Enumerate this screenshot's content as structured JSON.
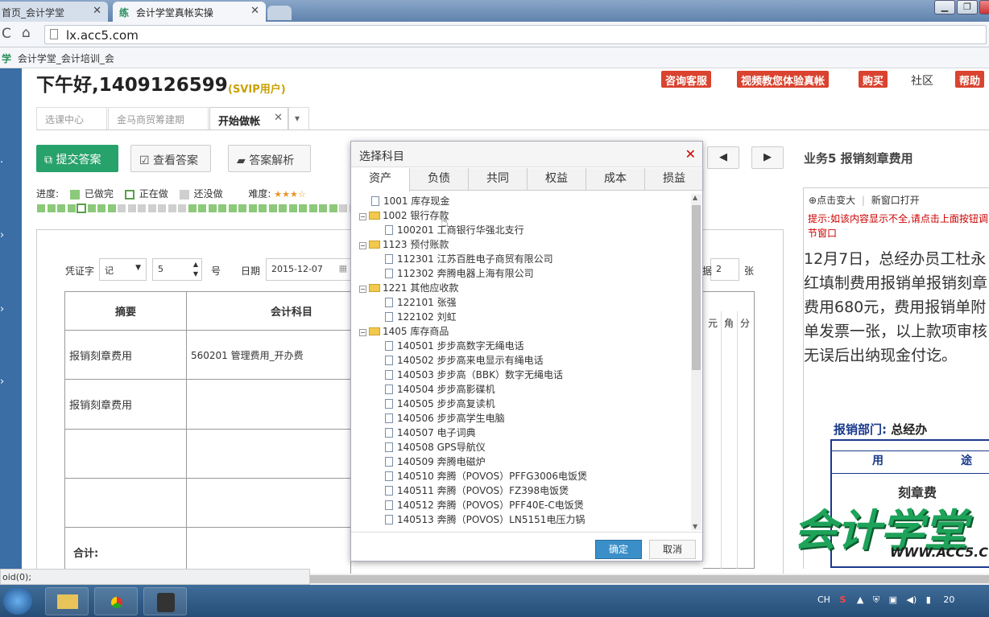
{
  "browser": {
    "tabs": [
      {
        "label": "首页_会计学堂"
      },
      {
        "label": "会计学堂真帐实操",
        "favicon": "练"
      }
    ],
    "url": "lx.acc5.com",
    "bookmark": "会计学堂_会计培训_会",
    "bookmark_icon": "学"
  },
  "header": {
    "greeting": "下午好,1409126599",
    "user_level": "(SVIP用户)",
    "buttons": [
      "咨询客服",
      "视频教您体验真帐",
      "购买",
      "帮助"
    ],
    "community": "社区"
  },
  "page_tabs": [
    "选课中心",
    "金马商贸筹建期",
    "开始做帐"
  ],
  "toolbar": {
    "submit": "提交答案",
    "view": "查看答案",
    "analysis": "答案解析"
  },
  "progress": {
    "label": "进度:",
    "done": "已做完",
    "doing": "正在做",
    "todo": "还没做",
    "difficulty": "难度:",
    "colors": {
      "done": "#8cc97a",
      "doing": "#ffffff",
      "todo": "#cfcfcf"
    }
  },
  "voucher": {
    "word_label": "凭证字",
    "word_value": "记",
    "number_value": "5",
    "number_unit": "号",
    "date_label": "日期",
    "date_value": "2015-12-07",
    "attach_value": "2",
    "attach_unit": "张",
    "col_summary": "摘要",
    "col_account": "会计科目",
    "money_cols": [
      "元",
      "角",
      "分"
    ],
    "rows": [
      {
        "summary": "报销刻章费用",
        "account": "560201 管理费用_开办费"
      },
      {
        "summary": "报销刻章费用",
        "account": ""
      }
    ],
    "total_label": "合计:"
  },
  "right_panel": {
    "title": "业务5 报销刻章费用",
    "tool_zoom": "点击变大",
    "tool_newwin": "新窗口打开",
    "hint": "提示:如该内容显示不全,请点击上面按钮调节窗口",
    "description": "12月7日，总经办员工杜永红填制费用报销单报销刻章费用680元，费用报销单附单发票一张，以上款项审核无误后出纳现金付讫。",
    "reimb_dept_label": "报销部门:",
    "reimb_dept_value": "总经办",
    "reimb_col1": "用",
    "reimb_col2": "途",
    "reimb_item": "刻章费",
    "watermark": "会计学堂",
    "watermark_url": "WWW.ACC5.C"
  },
  "dialog": {
    "title": "选择科目",
    "tabs": [
      "资产",
      "负债",
      "共同",
      "权益",
      "成本",
      "损益"
    ],
    "active_tab": "资产",
    "tree": [
      {
        "text": "1001 库存现金",
        "level": 0,
        "kind": "leaf"
      },
      {
        "text": "1002 银行存款",
        "level": 0,
        "kind": "folder"
      },
      {
        "text": "100201 工商银行华强北支行",
        "level": 1,
        "kind": "leaf"
      },
      {
        "text": "1123 预付账款",
        "level": 0,
        "kind": "folder"
      },
      {
        "text": "112301 江苏百胜电子商贸有限公司",
        "level": 1,
        "kind": "leaf"
      },
      {
        "text": "112302 奔腾电器上海有限公司",
        "level": 1,
        "kind": "leaf"
      },
      {
        "text": "1221 其他应收款",
        "level": 0,
        "kind": "folder"
      },
      {
        "text": "122101 张强",
        "level": 1,
        "kind": "leaf"
      },
      {
        "text": "122102 刘虹",
        "level": 1,
        "kind": "leaf"
      },
      {
        "text": "1405 库存商品",
        "level": 0,
        "kind": "folder"
      },
      {
        "text": "140501 步步高数字无绳电话",
        "level": 1,
        "kind": "leaf"
      },
      {
        "text": "140502 步步高来电显示有绳电话",
        "level": 1,
        "kind": "leaf"
      },
      {
        "text": "140503 步步高（BBK）数字无绳电话",
        "level": 1,
        "kind": "leaf"
      },
      {
        "text": "140504 步步高影碟机",
        "level": 1,
        "kind": "leaf"
      },
      {
        "text": "140505 步步高复读机",
        "level": 1,
        "kind": "leaf"
      },
      {
        "text": "140506 步步高学生电脑",
        "level": 1,
        "kind": "leaf"
      },
      {
        "text": "140507 电子词典",
        "level": 1,
        "kind": "leaf"
      },
      {
        "text": "140508 GPS导航仪",
        "level": 1,
        "kind": "leaf"
      },
      {
        "text": "140509 奔腾电磁炉",
        "level": 1,
        "kind": "leaf"
      },
      {
        "text": "140510 奔腾（POVOS）PFFG3006电饭煲",
        "level": 1,
        "kind": "leaf"
      },
      {
        "text": "140511 奔腾（POVOS）FZ398电饭煲",
        "level": 1,
        "kind": "leaf"
      },
      {
        "text": "140512 奔腾（POVOS）PFF40E-C电饭煲",
        "level": 1,
        "kind": "leaf"
      },
      {
        "text": "140513 奔腾（POVOS）LN5151电压力锅",
        "level": 1,
        "kind": "leaf"
      }
    ],
    "ok": "确定",
    "cancel": "取消"
  },
  "status": "oid(0);",
  "tray": {
    "lang": "CH",
    "clock": "20"
  }
}
